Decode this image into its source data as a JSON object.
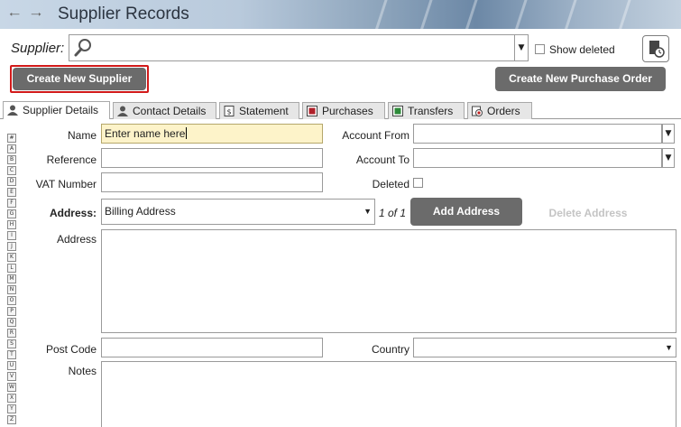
{
  "window": {
    "title": "Supplier Records"
  },
  "supplier": {
    "label": "Supplier:",
    "show_deleted_label": "Show deleted"
  },
  "buttons": {
    "create_supplier": "Create New Supplier",
    "create_po": "Create New Purchase Order",
    "add_address": "Add Address",
    "delete_address": "Delete Address"
  },
  "tabs": [
    {
      "label": "Supplier Details",
      "icon": "person-icon",
      "active": true
    },
    {
      "label": "Contact Details",
      "icon": "contact-icon",
      "active": false
    },
    {
      "label": "Statement",
      "icon": "statement-icon",
      "active": false
    },
    {
      "label": "Purchases",
      "icon": "purchases-icon",
      "active": false
    },
    {
      "label": "Transfers",
      "icon": "transfers-icon",
      "active": false
    },
    {
      "label": "Orders",
      "icon": "orders-icon",
      "active": false
    }
  ],
  "alphabet": [
    "#",
    "A",
    "B",
    "C",
    "D",
    "E",
    "F",
    "G",
    "H",
    "I",
    "J",
    "K",
    "L",
    "M",
    "N",
    "O",
    "P",
    "Q",
    "R",
    "S",
    "T",
    "U",
    "V",
    "W",
    "X",
    "Y",
    "Z"
  ],
  "form": {
    "name_label": "Name",
    "name_value": "Enter name here",
    "reference_label": "Reference",
    "vat_label": "VAT Number",
    "account_from_label": "Account From",
    "account_to_label": "Account To",
    "deleted_label": "Deleted",
    "address_select_label": "Address:",
    "address_select_value": "Billing Address",
    "address_pager": "1 of 1",
    "address_label": "Address",
    "postcode_label": "Post Code",
    "country_label": "Country",
    "notes_label": "Notes"
  },
  "colors": {
    "button_dark": "#6b6b6b",
    "highlight_border": "#d21a1a",
    "name_field_bg": "#fdf3c9"
  }
}
